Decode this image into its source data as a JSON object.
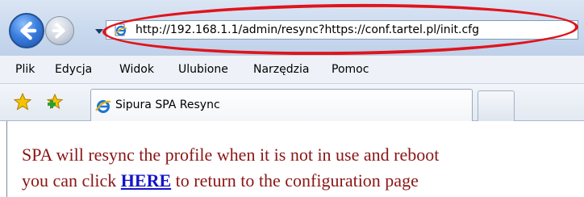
{
  "address_bar": {
    "url": "http://192.168.1.1/admin/resync?https://conf.tartel.pl/init.cfg",
    "highlight_color": "#e0141c"
  },
  "navigation": {
    "back_icon": "back-arrow-icon",
    "forward_icon": "forward-arrow-icon",
    "history_icon": "chevron-down-icon"
  },
  "menu": {
    "items": [
      "Plik",
      "Edycja",
      "Widok",
      "Ulubione",
      "Narzędzia",
      "Pomoc"
    ]
  },
  "favorites": {
    "star_icon": "favorites-star-icon",
    "add_icon": "add-favorite-icon"
  },
  "tab": {
    "title": "Sipura SPA Resync",
    "icon": "ie-page-icon"
  },
  "page": {
    "line1": "SPA will resync the profile when it is not in use and reboot",
    "line2_before": "you can click",
    "link_text": "HERE",
    "line2_after": "to return to the configuration page",
    "text_color": "#8b1515",
    "link_color": "#1414c8"
  }
}
